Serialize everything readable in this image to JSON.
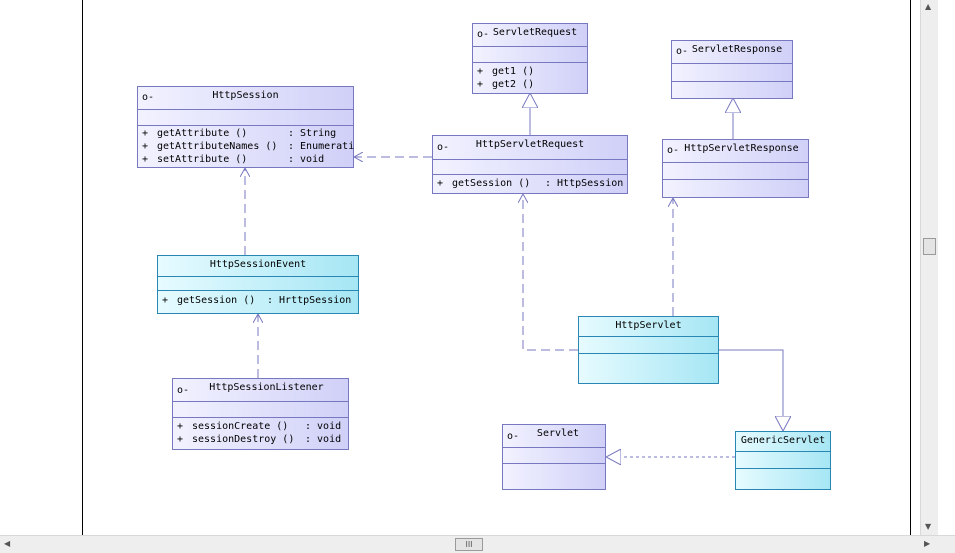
{
  "classes": {
    "http_session": {
      "name": "HttpSession",
      "vis": "o-",
      "members": [
        {
          "prefix": "+",
          "name": "getAttribute ()",
          "type": ": String"
        },
        {
          "prefix": "+",
          "name": "getAttributeNames ()",
          "type": ": Enumerati"
        },
        {
          "prefix": "+",
          "name": "setAttribute ()",
          "type": ": void"
        }
      ]
    },
    "servlet_request": {
      "name": "ServletRequest",
      "vis": "o-",
      "members": [
        {
          "prefix": "+",
          "name": "get1 ()",
          "type": ""
        },
        {
          "prefix": "+",
          "name": "get2 ()",
          "type": ""
        }
      ]
    },
    "servlet_response": {
      "name": "ServletResponse",
      "vis": "o-",
      "members": []
    },
    "http_servlet_request": {
      "name": "HttpServletRequest",
      "vis": "o-",
      "members": [
        {
          "prefix": "+",
          "name": "getSession ()",
          "type": ": HttpSession"
        }
      ]
    },
    "http_servlet_response": {
      "name": "HttpServletResponse",
      "vis": "o-",
      "members": []
    },
    "http_session_event": {
      "name": "HttpSessionEvent",
      "vis": "",
      "members": [
        {
          "prefix": "+",
          "name": "getSession ()",
          "type": ": HrttpSession"
        }
      ]
    },
    "http_session_listener": {
      "name": "HttpSessionListener",
      "vis": "o-",
      "members": [
        {
          "prefix": "+",
          "name": "sessionCreate ()",
          "type": ": void"
        },
        {
          "prefix": "+",
          "name": "sessionDestroy ()",
          "type": ": void"
        }
      ]
    },
    "http_servlet": {
      "name": "HttpServlet",
      "vis": "",
      "members": []
    },
    "servlet": {
      "name": "Servlet",
      "vis": "o-",
      "members": []
    },
    "generic_servlet": {
      "name": "GenericServlet",
      "vis": "",
      "members": []
    }
  },
  "scrollbar": {
    "thumb_label": "III"
  }
}
